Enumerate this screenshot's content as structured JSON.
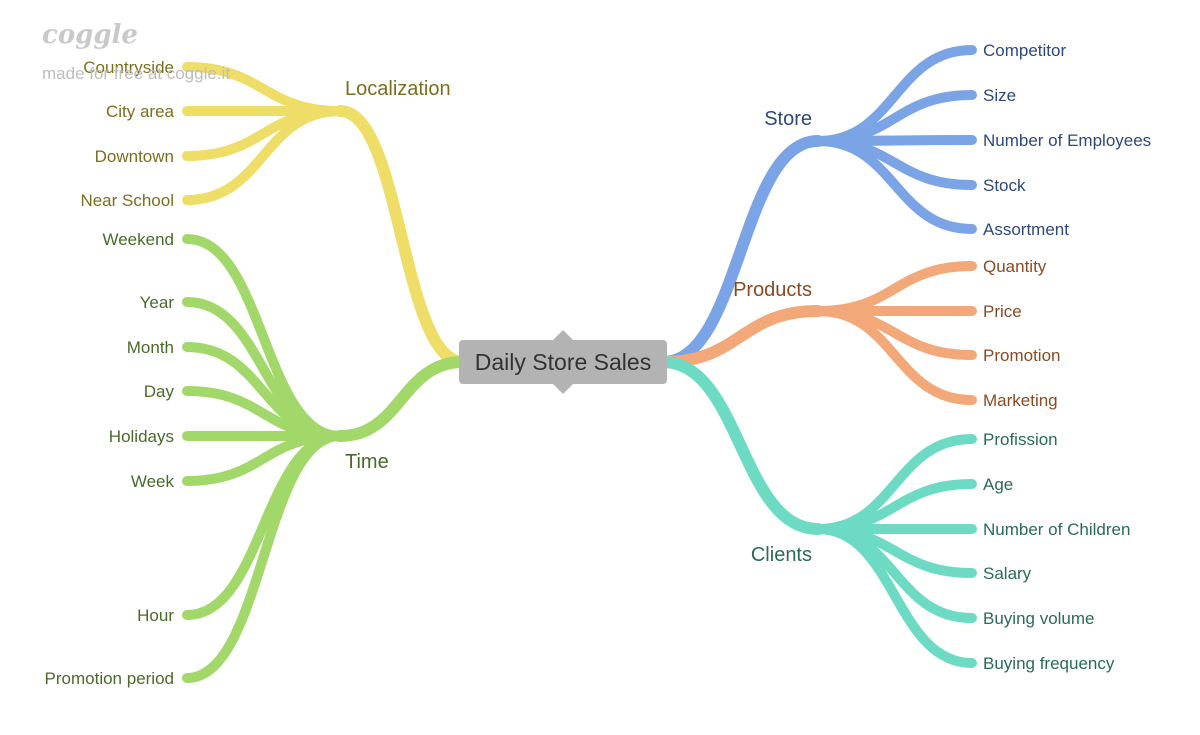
{
  "brand": {
    "logo_text": "coggle",
    "tagline": "made for free at coggle.it"
  },
  "root": {
    "label": "Daily Store Sales",
    "fill": "#b3b3b3",
    "text_color": "#333333"
  },
  "branches": [
    {
      "key": "localization",
      "label": "Localization",
      "side": "left",
      "color": "#eedd66",
      "text_color": "#7a6f1e",
      "children": [
        "Countryside",
        "City area",
        "Downtown",
        "Near School"
      ]
    },
    {
      "key": "time",
      "label": "Time",
      "side": "left",
      "color": "#a2d86a",
      "text_color": "#4a6a2a",
      "children": [
        "Weekend",
        "Year",
        "Month",
        "Day",
        "Holidays",
        "Week",
        "Hour",
        "Promotion period"
      ]
    },
    {
      "key": "store",
      "label": "Store",
      "side": "right",
      "color": "#7ba4e6",
      "text_color": "#2e4878",
      "children": [
        "Competitor",
        "Size",
        "Number of Employees",
        "Stock",
        "Assortment"
      ]
    },
    {
      "key": "products",
      "label": "Products",
      "side": "right",
      "color": "#f2a878",
      "text_color": "#8a4a22",
      "children": [
        "Quantity",
        "Price",
        "Promotion",
        "Marketing"
      ]
    },
    {
      "key": "clients",
      "label": "Clients",
      "side": "right",
      "color": "#6ddbc4",
      "text_color": "#2a6a5a",
      "children": [
        "Profission",
        "Age",
        "Number of Children",
        "Salary",
        "Buying volume",
        "Buying frequency"
      ]
    }
  ]
}
